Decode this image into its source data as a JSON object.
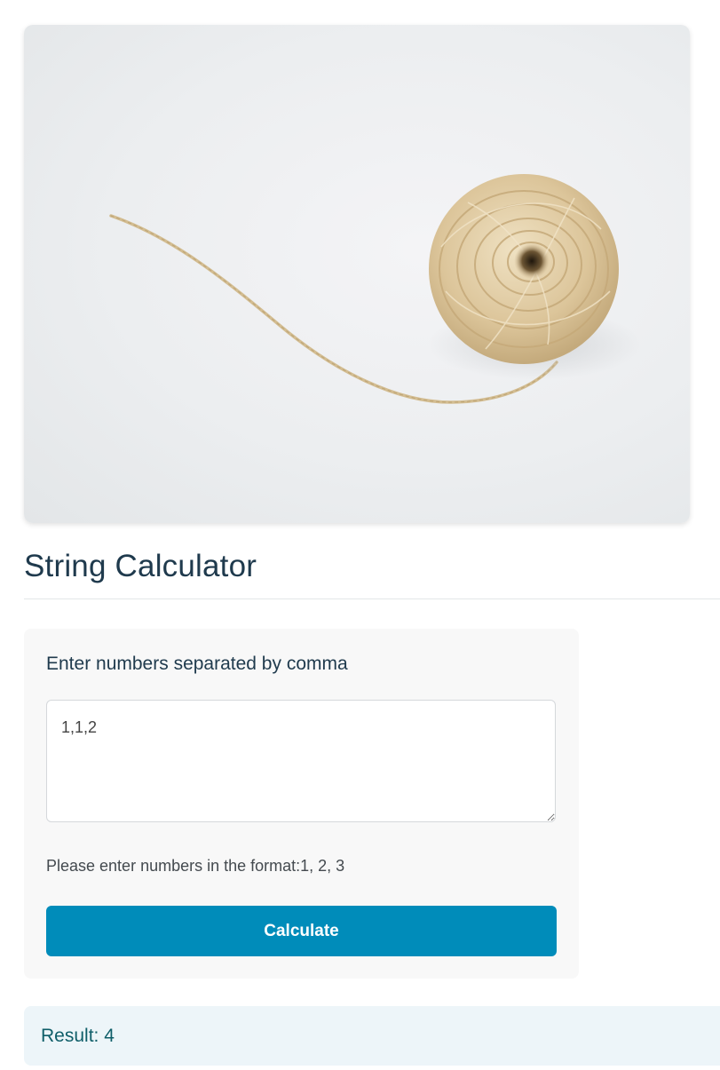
{
  "hero_image": {
    "icon": "yarn-ball-image"
  },
  "main": {
    "title": "String Calculator"
  },
  "form": {
    "label": "Enter numbers separated by comma",
    "input_value": "1,1,2",
    "hint": "Please enter numbers in the format:1, 2, 3",
    "button_label": "Calculate"
  },
  "result": {
    "text": "Result: 4"
  },
  "colors": {
    "accent": "#008cba",
    "title": "#1f3a4d",
    "result_text": "#0f5e69",
    "result_bg": "#edf5f9",
    "card_bg": "#f8f8f8"
  }
}
